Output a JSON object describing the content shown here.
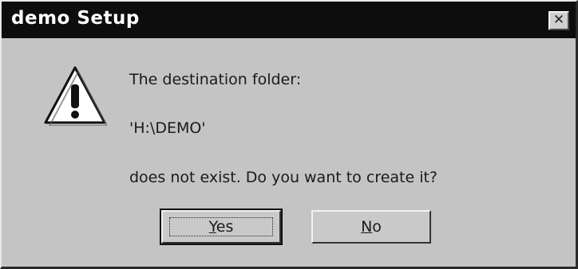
{
  "window": {
    "title": "demo Setup",
    "close_icon": "close-icon"
  },
  "message": {
    "icon": "warning-icon",
    "line1": "The destination folder:",
    "line2": "'H:\\DEMO'",
    "line3": "does not exist. Do you want to create it?"
  },
  "buttons": {
    "yes": {
      "mnemonic": "Y",
      "rest": "es"
    },
    "no": {
      "mnemonic": "N",
      "rest": "o"
    }
  }
}
